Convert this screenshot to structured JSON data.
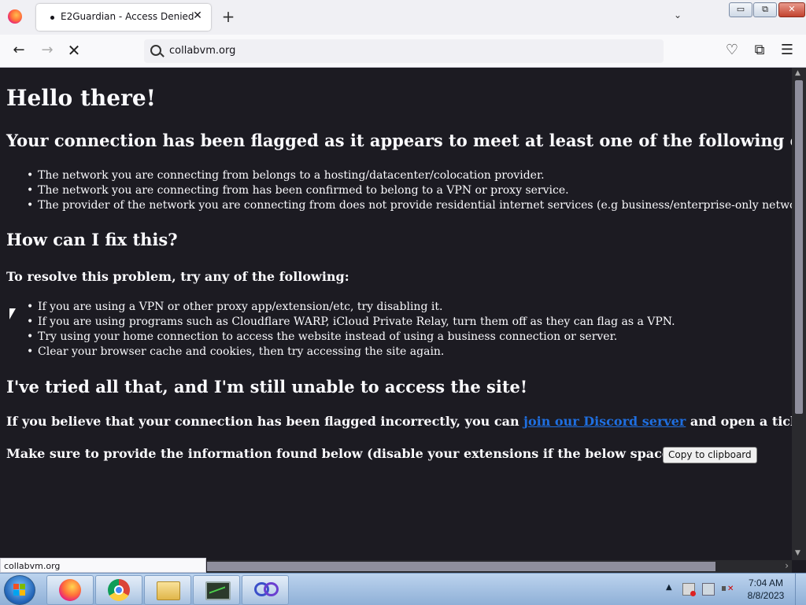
{
  "browser": {
    "tab_title": "E2Guardian - Access Denied",
    "tab_close": "✕",
    "new_tab": "+",
    "tab_list": "⌄",
    "url": "collabvm.org",
    "back": "←",
    "forward": "→",
    "reload": "✕",
    "pocket": "♡",
    "extensions": "⧉",
    "menu": "☰",
    "window_min": "▭",
    "window_max": "⧉",
    "window_close": "✕",
    "status_url": "collabvm.org"
  },
  "page": {
    "title": "Hello there!",
    "criteria_heading": "Your connection has been flagged as it appears to meet at least one of the following criteria:",
    "criteria": [
      "The network you are connecting from belongs to a hosting/datacenter/colocation provider.",
      "The network you are connecting from has been confirmed to belong to a VPN or proxy service.",
      "The provider of the network you are connecting from does not provide residential internet services (e.g business/enterprise-only networks)."
    ],
    "fix_heading": "How can I fix this?",
    "resolve_intro": "To resolve this problem, try any of the following:",
    "fixes": [
      "If you are using a VPN or other proxy app/extension/etc, try disabling it.",
      "If you are using programs such as Cloudflare WARP, iCloud Private Relay, turn them off as they can flag as a VPN.",
      "Try using your home connection to access the website instead of using a business connection or server.",
      "Clear your browser cache and cookies, then try accessing the site again."
    ],
    "still_heading": "I've tried all that, and I'm still unable to access the site!",
    "ticket_prefix": "If you believe that your connection has been flagged incorrectly, you can ",
    "discord_link": "join our Discord server",
    "ticket_suffix": " and open a ticket.",
    "info_text": "Make sure to provide the information found below (disable your extensions if the below space is empty):",
    "copy_button": "Copy to clipboard"
  },
  "taskbar": {
    "apps": [
      "firefox-icon",
      "chrome-icon",
      "file-explorer-icon",
      "task-manager-icon",
      "collabvm-icon"
    ],
    "time": "7:04 AM",
    "date": "8/8/2023"
  }
}
